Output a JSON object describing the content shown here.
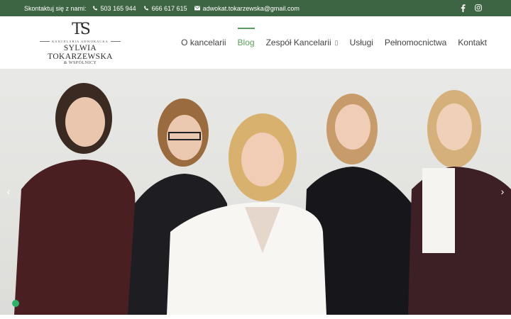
{
  "topbar": {
    "contact_label": "Skontaktuj się z nami:",
    "phone_1": "503 165 944",
    "phone_2": "666 617 615",
    "email": "adwokat.tokarzewska@gmail.com",
    "social": [
      "facebook-icon",
      "instagram-icon"
    ]
  },
  "logo": {
    "monogram": "TS",
    "small": "KANCELARIA ADWOKACKA",
    "name": "SYLWIA TOKARZEWSKA",
    "sub": "& WSPÓLNICY"
  },
  "nav": {
    "items": [
      {
        "label": "O kancelarii"
      },
      {
        "label": "Blog",
        "active": true
      },
      {
        "label": "Zespół Kancelarii"
      },
      {
        "label": "Usługi"
      },
      {
        "label": "Pełnomocnictwa"
      },
      {
        "label": "Kontakt"
      }
    ]
  },
  "hero": {
    "arrow_left": "‹",
    "arrow_right": "›"
  },
  "colors": {
    "topbar": "#3e6543",
    "accent": "#5b9e5c"
  }
}
